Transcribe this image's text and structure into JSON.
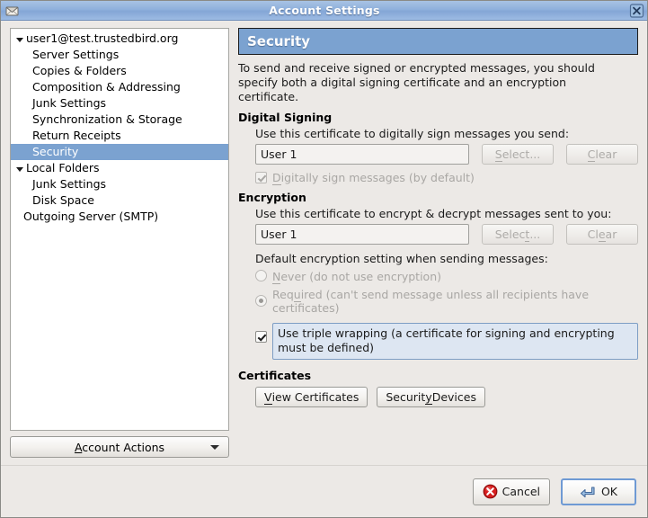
{
  "window": {
    "title": "Account Settings",
    "app_icon": "mail-envelope-icon",
    "close_icon": "close-icon"
  },
  "sidebar": {
    "tree": [
      {
        "label": "user1@test.trustedbird.org",
        "level": "root",
        "expanded": true,
        "selected": false
      },
      {
        "label": "Server Settings",
        "level": "child",
        "selected": false
      },
      {
        "label": "Copies & Folders",
        "level": "child",
        "selected": false
      },
      {
        "label": "Composition & Addressing",
        "level": "child",
        "selected": false
      },
      {
        "label": "Junk Settings",
        "level": "child",
        "selected": false
      },
      {
        "label": "Synchronization & Storage",
        "level": "child",
        "selected": false
      },
      {
        "label": "Return Receipts",
        "level": "child",
        "selected": false
      },
      {
        "label": "Security",
        "level": "child",
        "selected": true
      },
      {
        "label": "Local Folders",
        "level": "root",
        "expanded": true,
        "selected": false
      },
      {
        "label": "Junk Settings",
        "level": "child",
        "selected": false
      },
      {
        "label": "Disk Space",
        "level": "child",
        "selected": false
      },
      {
        "label": "Outgoing Server (SMTP)",
        "level": "child2",
        "selected": false
      }
    ],
    "account_actions": {
      "label": "Account Actions",
      "mnemonic": "A",
      "chevron_icon": "chevron-down-icon"
    }
  },
  "main": {
    "header": "Security",
    "intro": "To send and receive signed or encrypted messages, you should specify both a digital signing certificate and an encryption certificate.",
    "digital_signing": {
      "title": "Digital Signing",
      "description": "Use this certificate to digitally sign messages you send:",
      "certificate_value": "User 1",
      "select_label": "Select...",
      "select_mnemonic": "S",
      "clear_label": "Clear",
      "clear_mnemonic": "C",
      "buttons_disabled": true,
      "sign_checkbox": {
        "label": "Digitally sign messages (by default)",
        "mnemonic": "D",
        "checked": true,
        "disabled": true
      }
    },
    "encryption": {
      "title": "Encryption",
      "description": "Use this certificate to encrypt & decrypt messages sent to you:",
      "certificate_value": "User 1",
      "select_label": "Select...",
      "select_mnemonic": "t",
      "clear_label": "Clear",
      "clear_mnemonic": "e",
      "buttons_disabled": true,
      "default_setting_label": "Default encryption setting when sending messages:",
      "options": [
        {
          "label": "Never (do not use encryption)",
          "mnemonic": "N",
          "selected": false,
          "disabled": true
        },
        {
          "label": "Required (can't send message unless all recipients have certificates)",
          "mnemonic": "u",
          "selected": true,
          "disabled": true
        }
      ],
      "triple_wrapping": {
        "label": "Use triple wrapping (a certificate for signing and encrypting must be defined)",
        "checked": true,
        "disabled": false,
        "focused": true
      }
    },
    "certificates": {
      "title": "Certificates",
      "view_label": "View Certificates",
      "view_mnemonic": "V",
      "devices_label": "Security Devices",
      "devices_mnemonic": "y"
    }
  },
  "footer": {
    "cancel_label": "Cancel",
    "cancel_icon": "cancel-circle-icon",
    "ok_label": "OK",
    "ok_icon": "enter-arrow-icon"
  },
  "colors": {
    "selection_blue": "#7ba2d0",
    "titlebar_blue": "#8fb0dc",
    "window_bg": "#ece9e6",
    "focus_blue": "#7d9dc4",
    "cancel_red": "#cc1111"
  }
}
